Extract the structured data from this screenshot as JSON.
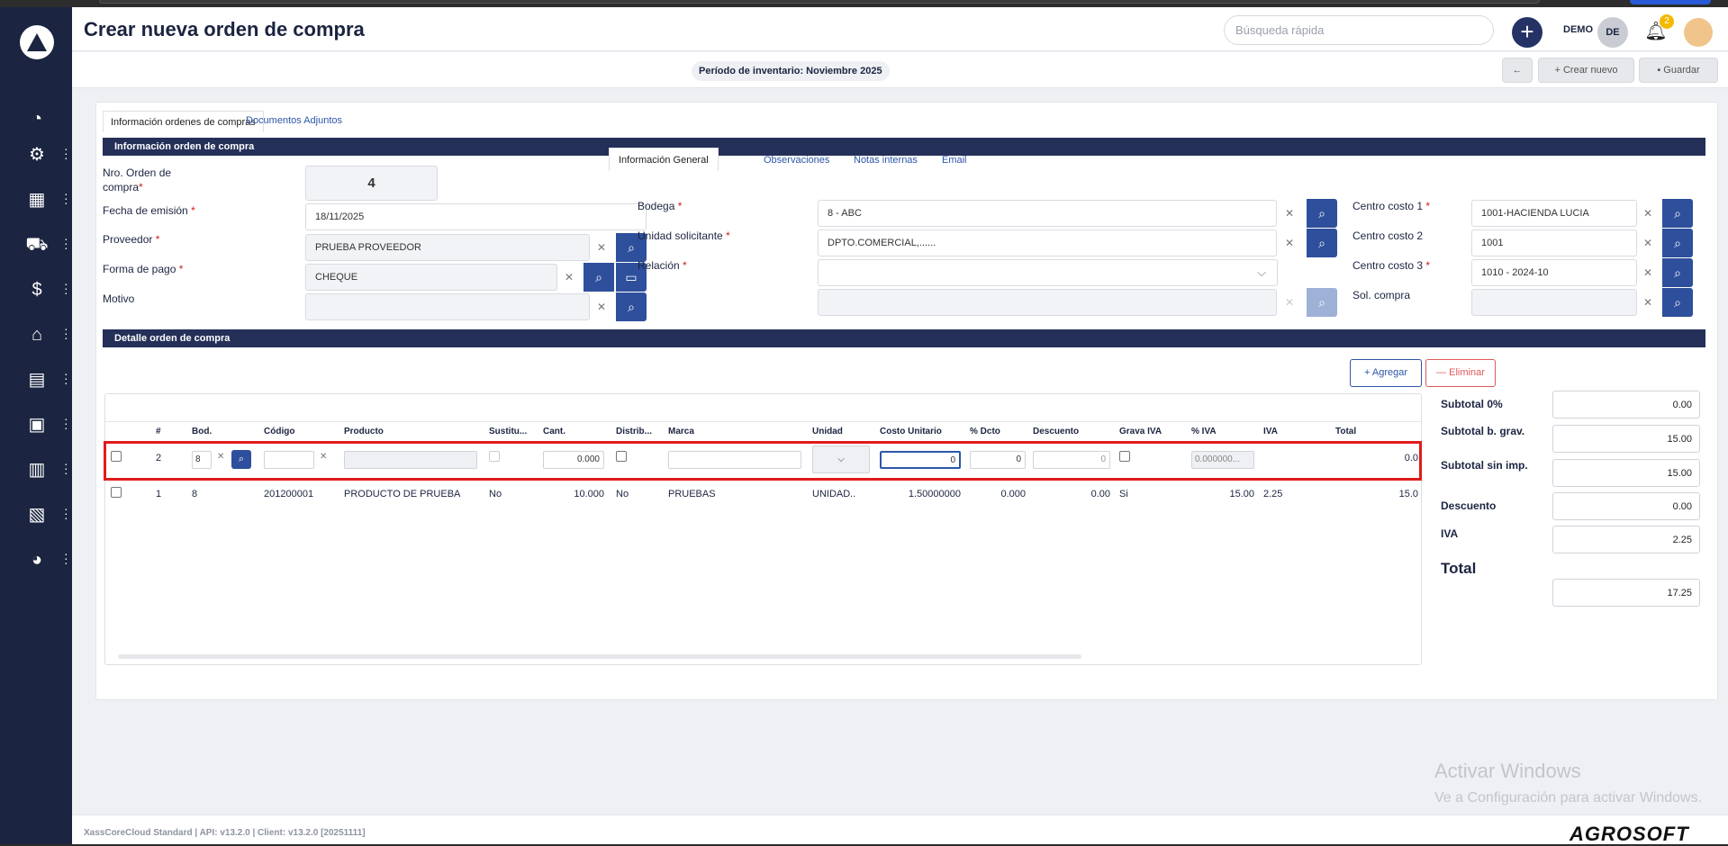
{
  "header": {
    "title": "Crear nueva orden de compra",
    "search_placeholder": "Búsqueda rápida",
    "user_label": "DEMO",
    "avatar_initials": "DE",
    "notification_count": "2"
  },
  "subbar": {
    "period": "Período de inventario: Noviembre 2025",
    "back_icon": "←",
    "create_new": "Crear nuevo",
    "save": "Guardar"
  },
  "tabs": [
    "Información ordenes de compras",
    "Documentos Adjuntos"
  ],
  "sections": {
    "info": "Información orden de compra",
    "detail": "Detalle orden de compra"
  },
  "form": {
    "order_no_label": "Nro. Orden de compra",
    "order_no": "4",
    "emission_label": "Fecha de emisión",
    "emission_date": "18/11/2025",
    "provider_label": "Proveedor",
    "provider": "PRUEBA PROVEEDOR",
    "payment_label": "Forma de pago",
    "payment": "CHEQUE",
    "reason_label": "Motivo",
    "reason": ""
  },
  "inner_tabs": [
    "Información General",
    "Observaciones",
    "Notas internas",
    "Email"
  ],
  "general": {
    "warehouse_label": "Bodega",
    "warehouse": "8 - ABC",
    "unit_label": "Unidad solicitante",
    "unit": "DPTO.COMERCIAL,......",
    "relation_label": "Relación",
    "relation": ""
  },
  "costs": {
    "cc1_label": "Centro costo 1",
    "cc1": "1001-HACIENDA LUCIA",
    "cc2_label": "Centro costo 2",
    "cc2": "1001",
    "cc3_label": "Centro costo 3",
    "cc3": "1010 - 2024-10",
    "sol_label": "Sol. compra",
    "sol": ""
  },
  "buttons": {
    "add": "Agregar",
    "remove": "Eliminar"
  },
  "table": {
    "columns": [
      "#",
      "Bod.",
      "Código",
      "Producto",
      "Sustitu...",
      "Cant.",
      "Distrib...",
      "Marca",
      "Unidad",
      "Costo Unitario",
      "% Dcto",
      "Descuento",
      "Grava IVA",
      "% IVA",
      "IVA",
      "Total"
    ],
    "edit_row": {
      "num": "2",
      "bod": "8",
      "cant": "0.000",
      "costo": "0",
      "dcto": "0",
      "descuento": "0",
      "piva": "0.000000...",
      "total": "0.0"
    },
    "rows": [
      {
        "num": "1",
        "bod": "8",
        "codigo": "201200001",
        "producto": "PRODUCTO DE PRUEBA",
        "sustituto": "No",
        "cant": "10.000",
        "distrib": "No",
        "marca": "PRUEBAS",
        "unidad": "UNIDAD..",
        "costo": "1.50000000",
        "dcto": "0.000",
        "descuento": "0.00",
        "grava": "Si",
        "piva": "15.00",
        "iva": "2.25",
        "total": "15.0"
      }
    ]
  },
  "totals": {
    "sub0_label": "Subtotal 0%",
    "sub0": "0.00",
    "subgrav_label": "Subtotal b. grav.",
    "subgrav": "15.00",
    "subsin_label": "Subtotal sin imp.",
    "subsin": "15.00",
    "desc_label": "Descuento",
    "desc": "0.00",
    "iva_label": "IVA",
    "iva": "2.25",
    "total_label": "Total",
    "total": "17.25"
  },
  "footer": {
    "version": "XassCoreCloud Standard | API: v13.2.0 | Client: v13.2.0 [20251111]",
    "brand": "AGROSOFT"
  },
  "watermark": {
    "line1": "Activar Windows",
    "line2": "Ve a Configuración para activar Windows."
  },
  "sidebar_icons": [
    "dashboard-icon",
    "settings-icon",
    "calculator-icon",
    "cart-icon",
    "money-icon",
    "store-icon",
    "cash-register-icon",
    "box-icon",
    "building-icon",
    "receipt-icon",
    "pie-chart-icon"
  ]
}
